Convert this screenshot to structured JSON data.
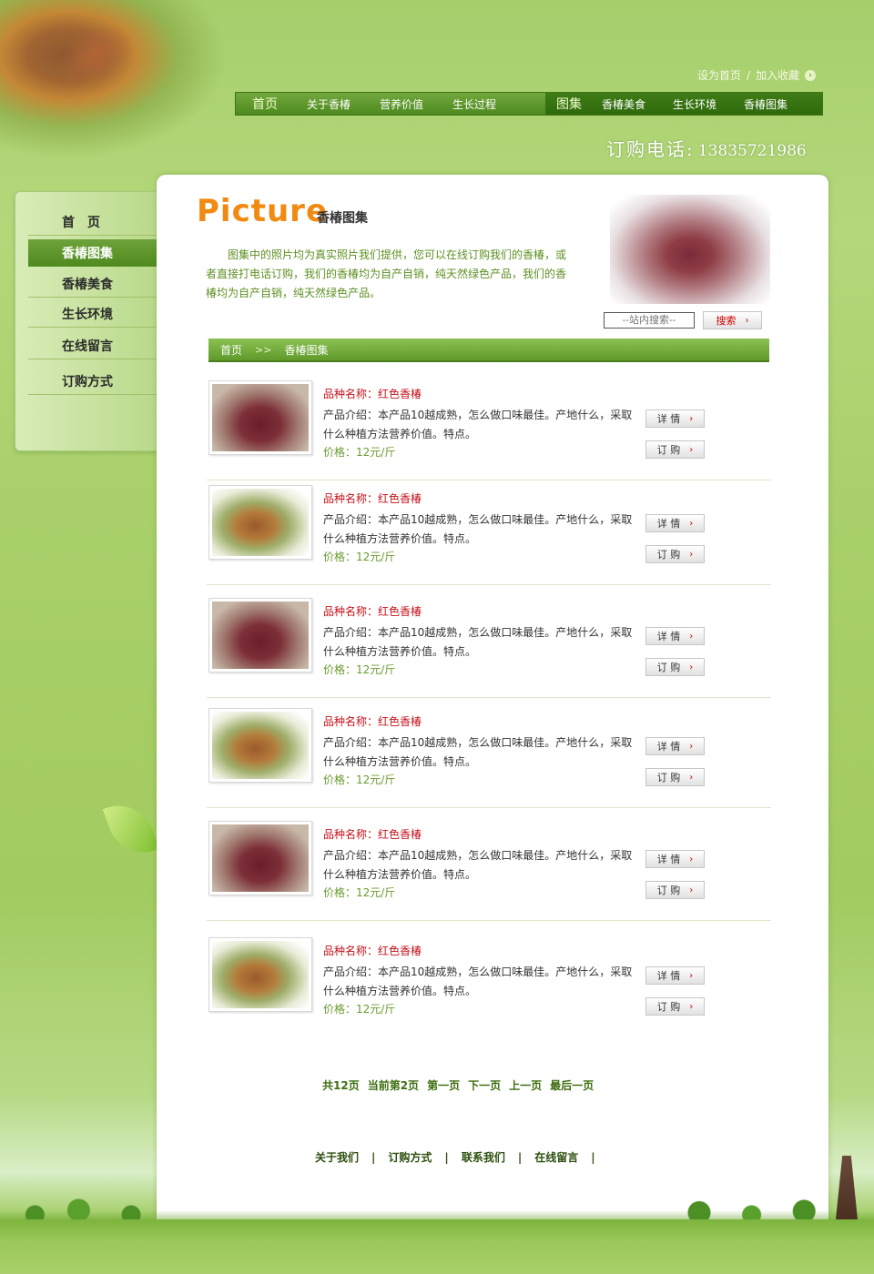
{
  "header": {
    "top_links": {
      "set_home": "设为首页",
      "separator": "/",
      "add_favorite": "加入收藏"
    },
    "nav_left": [
      "首页",
      "关于香椿",
      "营养价值",
      "生长过程"
    ],
    "nav_right": [
      "图集",
      "香椿美食",
      "生长环境",
      "香椿图集"
    ],
    "phone_label": "订购电话:",
    "phone_number": "13835721986"
  },
  "sidebar": {
    "items": [
      {
        "label": "首　页",
        "active": false
      },
      {
        "label": "香椿图集",
        "active": true
      },
      {
        "label": "香椿美食",
        "active": false
      },
      {
        "label": "生长环境",
        "active": false
      },
      {
        "label": "在线留言",
        "active": false
      },
      {
        "label": "订购方式",
        "active": false
      }
    ]
  },
  "main": {
    "title": "Picture",
    "subtitle": "香椿图集",
    "intro": "图集中的照片均为真实照片我们提供，您可以在线订购我们的香椿，或者直接打电话订购，我们的香椿均为自产自销，纯天然绿色产品，我们的香椿均为自产自销，纯天然绿色产品。",
    "search": {
      "placeholder": "--站内搜索--",
      "button": "搜索"
    },
    "breadcrumb": {
      "home": "首页",
      "separator": ">>",
      "current": "香椿图集"
    }
  },
  "products": [
    {
      "name": "品种名称：红色香椿",
      "desc": "产品介绍：本产品10越成熟，怎么做口味最佳。产地什么，采取什么种植方法营养价值。特点。",
      "price": "价格：12元/斤",
      "detail": "详 情",
      "order": "订 购",
      "image": "red-toon-sprout"
    },
    {
      "name": "品种名称：红色香椿",
      "desc": "产品介绍：本产品10越成熟，怎么做口味最佳。产地什么，采取什么种植方法营养价值。特点。",
      "price": "价格：12元/斤",
      "detail": "详 情",
      "order": "订 购",
      "image": "green-toon-sprout"
    },
    {
      "name": "品种名称：红色香椿",
      "desc": "产品介绍：本产品10越成熟，怎么做口味最佳。产地什么，采取什么种植方法营养价值。特点。",
      "price": "价格：12元/斤",
      "detail": "详 情",
      "order": "订 购",
      "image": "red-toon-sprout"
    },
    {
      "name": "品种名称：红色香椿",
      "desc": "产品介绍：本产品10越成熟，怎么做口味最佳。产地什么，采取什么种植方法营养价值。特点。",
      "price": "价格：12元/斤",
      "detail": "详 情",
      "order": "订 购",
      "image": "green-toon-sprout"
    },
    {
      "name": "品种名称：红色香椿",
      "desc": "产品介绍：本产品10越成熟，怎么做口味最佳。产地什么，采取什么种植方法营养价值。特点。",
      "price": "价格：12元/斤",
      "detail": "详 情",
      "order": "订 购",
      "image": "red-toon-sprout"
    },
    {
      "name": "品种名称：红色香椿",
      "desc": "产品介绍：本产品10越成熟，怎么做口味最佳。产地什么，采取什么种植方法营养价值。特点。",
      "price": "价格：12元/斤",
      "detail": "详 情",
      "order": "订 购",
      "image": "green-toon-sprout"
    }
  ],
  "pager": {
    "total": "共12页",
    "current": "当前第2页",
    "first": "第一页",
    "next": "下一页",
    "prev": "上一页",
    "last": "最后一页"
  },
  "footer": {
    "links": [
      "关于我们",
      "订购方式",
      "联系我们",
      "在线留言"
    ],
    "separator": "|"
  },
  "colors": {
    "page_bg": "#a6cf6c",
    "nav_bg": "#4d8a1e",
    "accent_orange": "#f08a12",
    "name_red": "#c4121b",
    "price_green": "#6a9a2c"
  }
}
